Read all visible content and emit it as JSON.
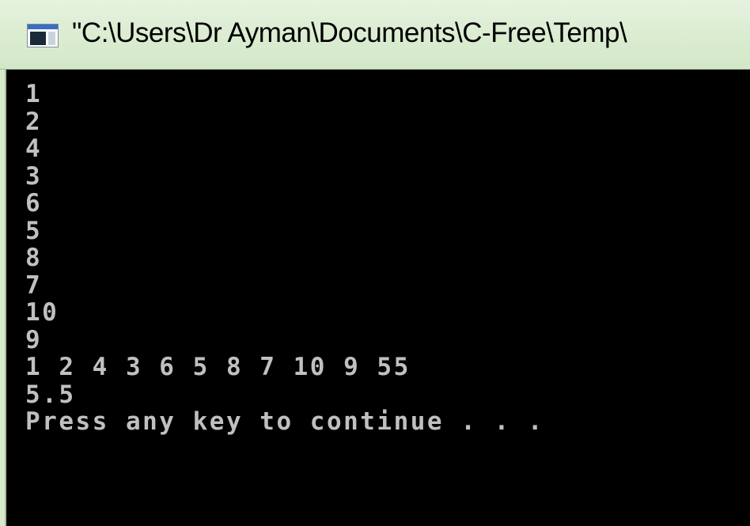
{
  "window": {
    "title": "\"C:\\Users\\Dr Ayman\\Documents\\C-Free\\Temp\\",
    "icon": "console-window-icon"
  },
  "console": {
    "lines": [
      "1",
      "2",
      "4",
      "3",
      "6",
      "5",
      "8",
      "7",
      "10",
      "9",
      "1 2 4 3 6 5 8 7 10 9 55",
      "5.5",
      "Press any key to continue . . ."
    ]
  }
}
